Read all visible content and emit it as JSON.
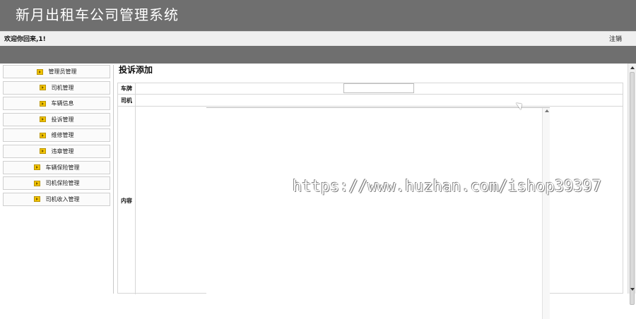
{
  "header": {
    "app_title": "新月出租车公司管理系统",
    "welcome_text": "欢迎你回来,1!",
    "logout_label": "注销",
    "colors": {
      "bar": "#6f6f6f",
      "userbar": "#efefef"
    }
  },
  "sidebar": {
    "items": [
      {
        "label": "管理员管理",
        "icon": "arrow-right-icon"
      },
      {
        "label": "司机管理",
        "icon": "arrow-right-icon"
      },
      {
        "label": "车辆信息",
        "icon": "arrow-right-icon"
      },
      {
        "label": "投诉管理",
        "icon": "arrow-right-icon"
      },
      {
        "label": "维修管理",
        "icon": "arrow-right-icon"
      },
      {
        "label": "违章管理",
        "icon": "arrow-right-icon"
      },
      {
        "label": "车辆保险管理",
        "icon": "arrow-right-icon"
      },
      {
        "label": "司机保险管理",
        "icon": "arrow-right-icon"
      },
      {
        "label": "司机收入管理",
        "icon": "arrow-right-icon"
      }
    ]
  },
  "main": {
    "page_title": "投诉添加",
    "fields": [
      {
        "label": "车牌",
        "value": ""
      },
      {
        "label": "司机",
        "value": ""
      },
      {
        "label": "内容",
        "value": ""
      }
    ]
  },
  "watermark": "https://www.huzhan.com/ishop39397"
}
